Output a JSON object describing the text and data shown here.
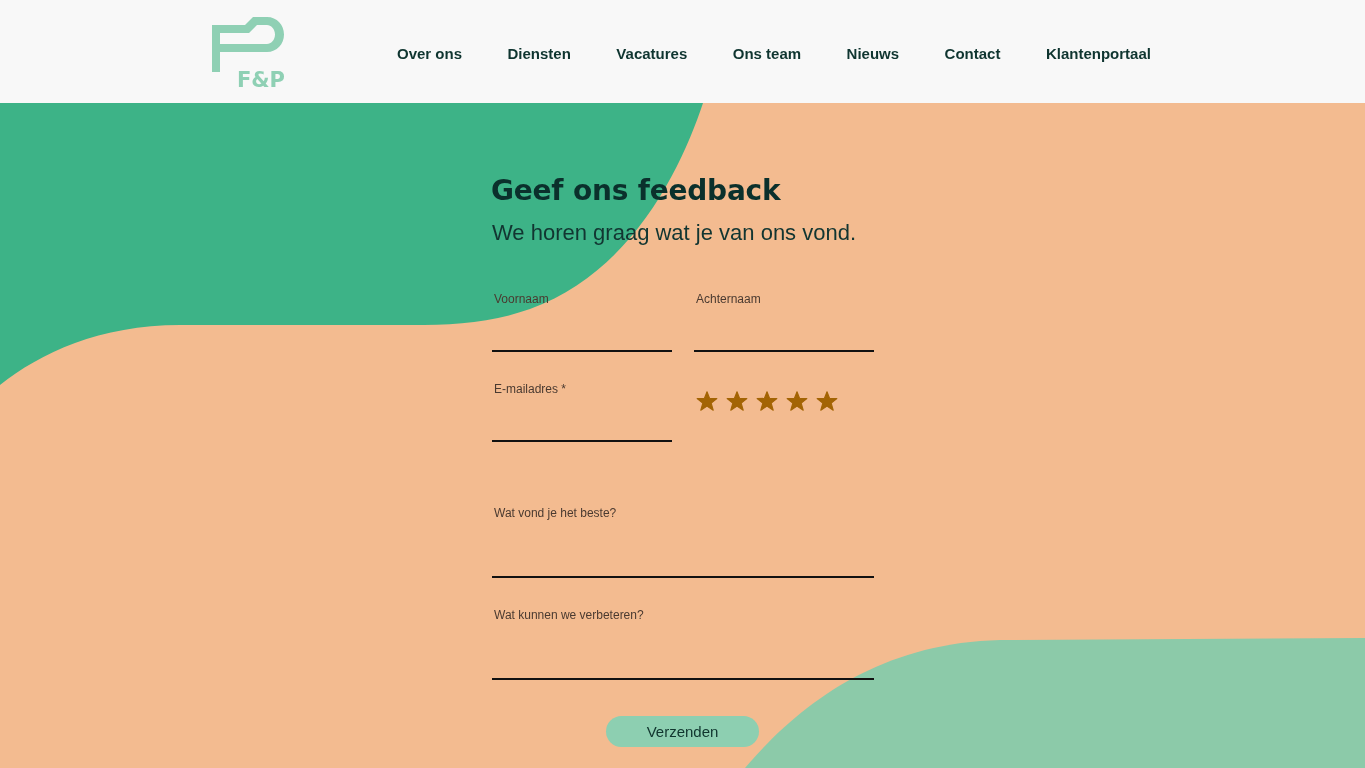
{
  "header": {
    "logo_text": "F&P",
    "nav": [
      "Over ons",
      "Diensten",
      "Vacatures",
      "Ons team",
      "Nieuws",
      "Contact",
      "Klantenportaal"
    ]
  },
  "form": {
    "title": "Geef ons feedback",
    "subtitle": "We horen graag wat je van ons vond.",
    "fields": [
      {
        "kind": "text",
        "label": "Voornaam"
      },
      {
        "kind": "text",
        "label": "Achternaam"
      },
      {
        "kind": "text",
        "label": "E-mailadres *"
      },
      {
        "kind": "rating",
        "stars": 5
      },
      {
        "kind": "long",
        "label": "Wat vond je het beste?"
      },
      {
        "kind": "long",
        "label": "Wat kunnen we verbeteren?"
      }
    ],
    "submit": "Verzenden"
  }
}
